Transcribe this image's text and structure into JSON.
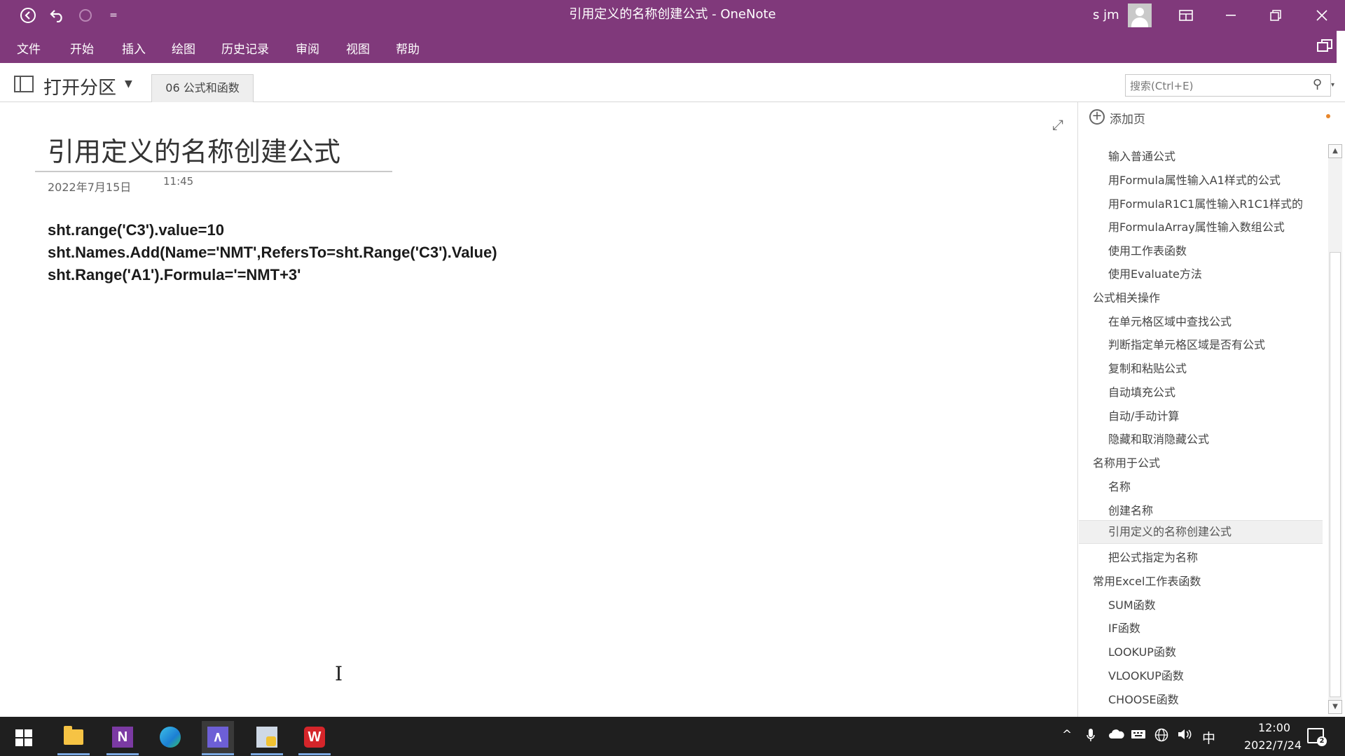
{
  "window": {
    "title": "引用定义的名称创建公式 - OneNote",
    "user_name": "s jm",
    "quick_access_more": "="
  },
  "menu": [
    "文件",
    "开始",
    "插入",
    "绘图",
    "历史记录",
    "审阅",
    "视图",
    "帮助"
  ],
  "section_bar": {
    "open_section_label": "打开分区",
    "active_section_tab": "06 公式和函数",
    "search_placeholder": "搜索(Ctrl+E)"
  },
  "page": {
    "title": "引用定义的名称创建公式",
    "date": "2022年7月15日",
    "time": "11:45",
    "code_lines": [
      "sht.range('C3').value=10",
      "sht.Names.Add(Name='NMT',RefersTo=sht.Range('C3').Value)",
      "sht.Range('A1').Formula='=NMT+3'"
    ]
  },
  "pages_pane": {
    "add_page_label": "添加页",
    "items": [
      {
        "label": "输入普通公式",
        "level": 1
      },
      {
        "label": "用Formula属性输入A1样式的公式",
        "level": 1
      },
      {
        "label": "用FormulaR1C1属性输入R1C1样式的",
        "level": 1
      },
      {
        "label": "用FormulaArray属性输入数组公式",
        "level": 1
      },
      {
        "label": "使用工作表函数",
        "level": 1
      },
      {
        "label": "使用Evaluate方法",
        "level": 1
      },
      {
        "label": "公式相关操作",
        "level": 0
      },
      {
        "label": "在单元格区域中查找公式",
        "level": 1
      },
      {
        "label": "判断指定单元格区域是否有公式",
        "level": 1
      },
      {
        "label": "复制和粘贴公式",
        "level": 1
      },
      {
        "label": "自动填充公式",
        "level": 1
      },
      {
        "label": "自动/手动计算",
        "level": 1
      },
      {
        "label": "隐藏和取消隐藏公式",
        "level": 1
      },
      {
        "label": "名称用于公式",
        "level": 0
      },
      {
        "label": "名称",
        "level": 1
      },
      {
        "label": "创建名称",
        "level": 1
      },
      {
        "label": "引用定义的名称创建公式",
        "level": 1,
        "selected": true
      },
      {
        "label": "把公式指定为名称",
        "level": 1
      },
      {
        "label": "常用Excel工作表函数",
        "level": 0
      },
      {
        "label": "SUM函数",
        "level": 1
      },
      {
        "label": "IF函数",
        "level": 1
      },
      {
        "label": "LOOKUP函数",
        "level": 1
      },
      {
        "label": "VLOOKUP函数",
        "level": 1
      },
      {
        "label": "CHOOSE函数",
        "level": 1
      }
    ]
  },
  "taskbar": {
    "apps": [
      "file-explorer",
      "onenote",
      "edge",
      "visual-studio",
      "python-editor",
      "wps-office"
    ],
    "ime_label": "中",
    "clock_time": "12:00",
    "clock_date": "2022/7/24",
    "notification_count": "2"
  },
  "colors": {
    "accent": "#80397b",
    "taskbar": "#1f1f1f"
  }
}
